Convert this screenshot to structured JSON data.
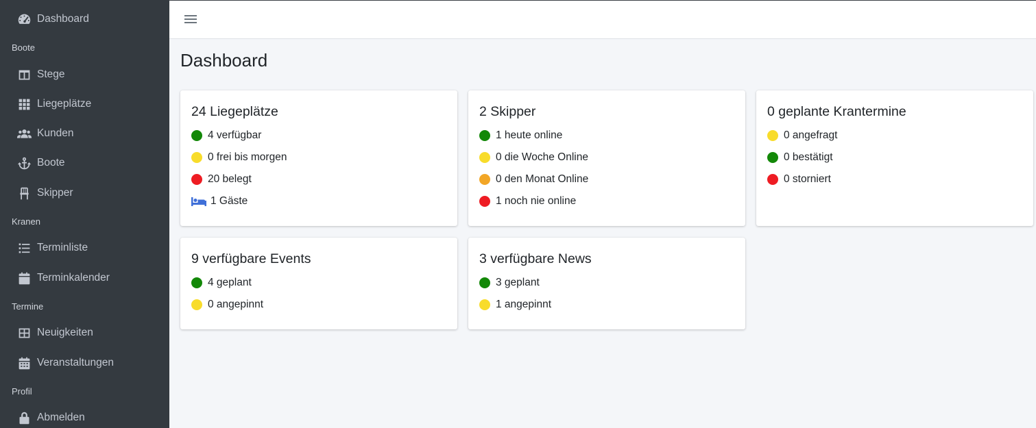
{
  "sidebar": {
    "items": [
      {
        "label": "Dashboard"
      },
      {
        "label": "Stege"
      },
      {
        "label": "Liegeplätze"
      },
      {
        "label": "Kunden"
      },
      {
        "label": "Boote"
      },
      {
        "label": "Skipper"
      },
      {
        "label": "Terminliste"
      },
      {
        "label": "Terminkalender"
      },
      {
        "label": "Neuigkeiten"
      },
      {
        "label": "Veranstaltungen"
      },
      {
        "label": "Abmelden"
      }
    ],
    "headers": [
      "Boote",
      "Kranen",
      "Termine",
      "Profil"
    ]
  },
  "main": {
    "title": "Dashboard",
    "cards": [
      {
        "title": "24 Liegeplätze",
        "stats": [
          "4 verfügbar",
          "0 frei bis morgen",
          "20 belegt",
          "1 Gäste"
        ]
      },
      {
        "title": "2 Skipper",
        "stats": [
          "1 heute online",
          "0 die Woche Online",
          "0 den Monat Online",
          "1 noch nie online"
        ]
      },
      {
        "title": "0 geplante Krantermine",
        "stats": [
          "0 angefragt",
          "0 bestätigt",
          "0 storniert"
        ]
      },
      {
        "title": "9 verfügbare Events",
        "stats": [
          "4 geplant",
          "0 angepinnt"
        ]
      },
      {
        "title": "3 verfügbare News",
        "stats": [
          "3 geplant",
          "1 angepinnt"
        ]
      }
    ]
  },
  "colors": {
    "sidebar_bg": "#343a40",
    "status_green": "#138808",
    "status_yellow": "#f8dc2b",
    "status_orange": "#f2a626",
    "status_red": "#ee1c23",
    "guest_blue": "#3f6fd8"
  },
  "icons": {
    "dashboard": "tachometer-icon",
    "stege": "columns-icon",
    "liegeplaetze": "grid-icon",
    "kunden": "users-icon",
    "boote": "anchor-icon",
    "skipper": "chair-icon",
    "terminliste": "list-icon",
    "terminkalender": "calendar-icon",
    "neuigkeiten": "table-icon",
    "veranstaltungen": "calendar-grid-icon",
    "abmelden": "lock-icon",
    "menu": "hamburger-icon",
    "guest": "bed-icon"
  }
}
